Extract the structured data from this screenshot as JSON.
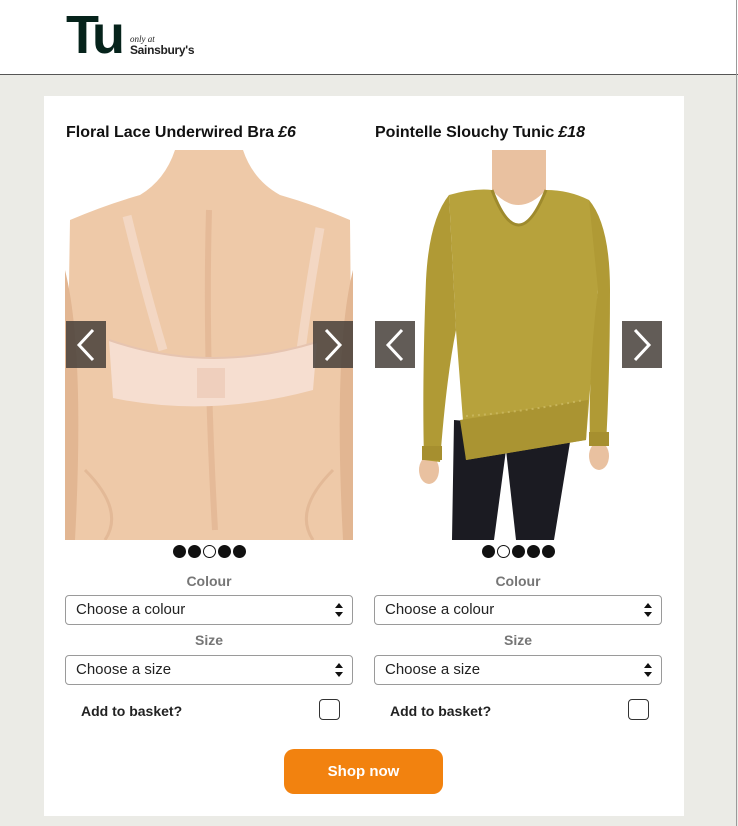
{
  "brand": {
    "logo_mark": "Tu",
    "logo_onlyat": "only at",
    "logo_store": "Sainsbury's"
  },
  "products": [
    {
      "name": "Floral Lace Underwired Bra",
      "price": "£6",
      "image_icon": "bra-back-photo",
      "dots_total": 5,
      "active_dot": 3,
      "colour_label": "Colour",
      "colour_placeholder": "Choose a colour",
      "size_label": "Size",
      "size_placeholder": "Choose a size",
      "basket_label": "Add to basket?",
      "basket_checked": false
    },
    {
      "name": "Pointelle Slouchy Tunic",
      "price": "£18",
      "image_icon": "tunic-model-photo",
      "dots_total": 5,
      "active_dot": 2,
      "colour_label": "Colour",
      "colour_placeholder": "Choose a colour",
      "size_label": "Size",
      "size_placeholder": "Choose a size",
      "basket_label": "Add to basket?",
      "basket_checked": false
    }
  ],
  "cta": {
    "label": "Shop now"
  },
  "colors": {
    "accent": "#f2820f",
    "logo": "#06231b",
    "background": "#ebebe6"
  }
}
